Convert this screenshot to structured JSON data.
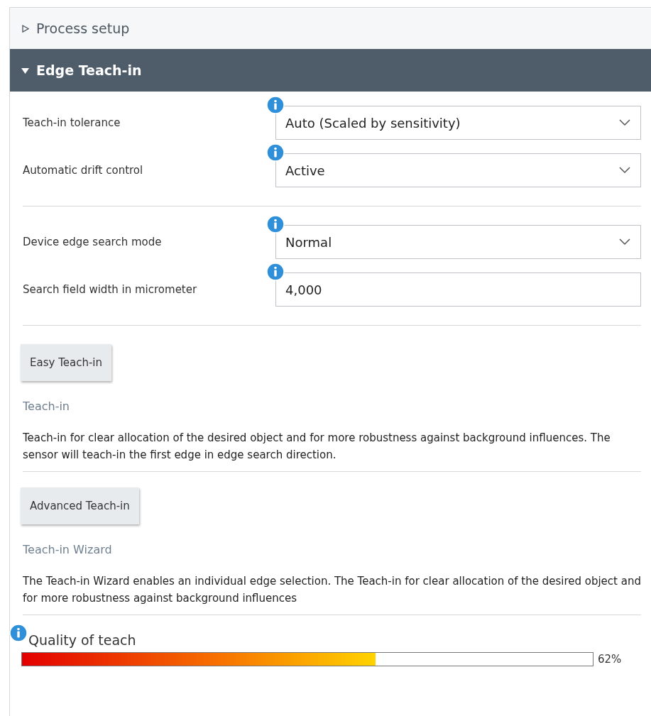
{
  "sections": [
    {
      "title": "Process setup",
      "expanded": false
    },
    {
      "title": "Edge Teach-in",
      "expanded": true
    }
  ],
  "field_groups": [
    [
      {
        "kind": "select",
        "label": "Teach-in tolerance",
        "value": "Auto (Scaled by sensitivity)"
      },
      {
        "kind": "select",
        "label": "Automatic drift control",
        "value": "Active"
      }
    ],
    [
      {
        "kind": "select",
        "label": "Device edge search mode",
        "value": "Normal"
      },
      {
        "kind": "input",
        "label": "Search field width in micrometer",
        "value": "4,000"
      }
    ]
  ],
  "teach_blocks": [
    {
      "button": "Easy Teach-in",
      "subtitle": "Teach-in",
      "description": "Teach-in for clear allocation of the desired object and for more robustness against background influences. The sensor will teach-in the first edge in edge search direction."
    },
    {
      "button": "Advanced Teach-in",
      "subtitle": "Teach-in Wizard",
      "description": "The Teach-in Wizard enables an individual edge selection. The Teach-in for clear allocation of the desired object and for more robustness against background influences"
    }
  ],
  "quality": {
    "label": "Quality of teach",
    "level": 0.62,
    "reading": "62%"
  }
}
